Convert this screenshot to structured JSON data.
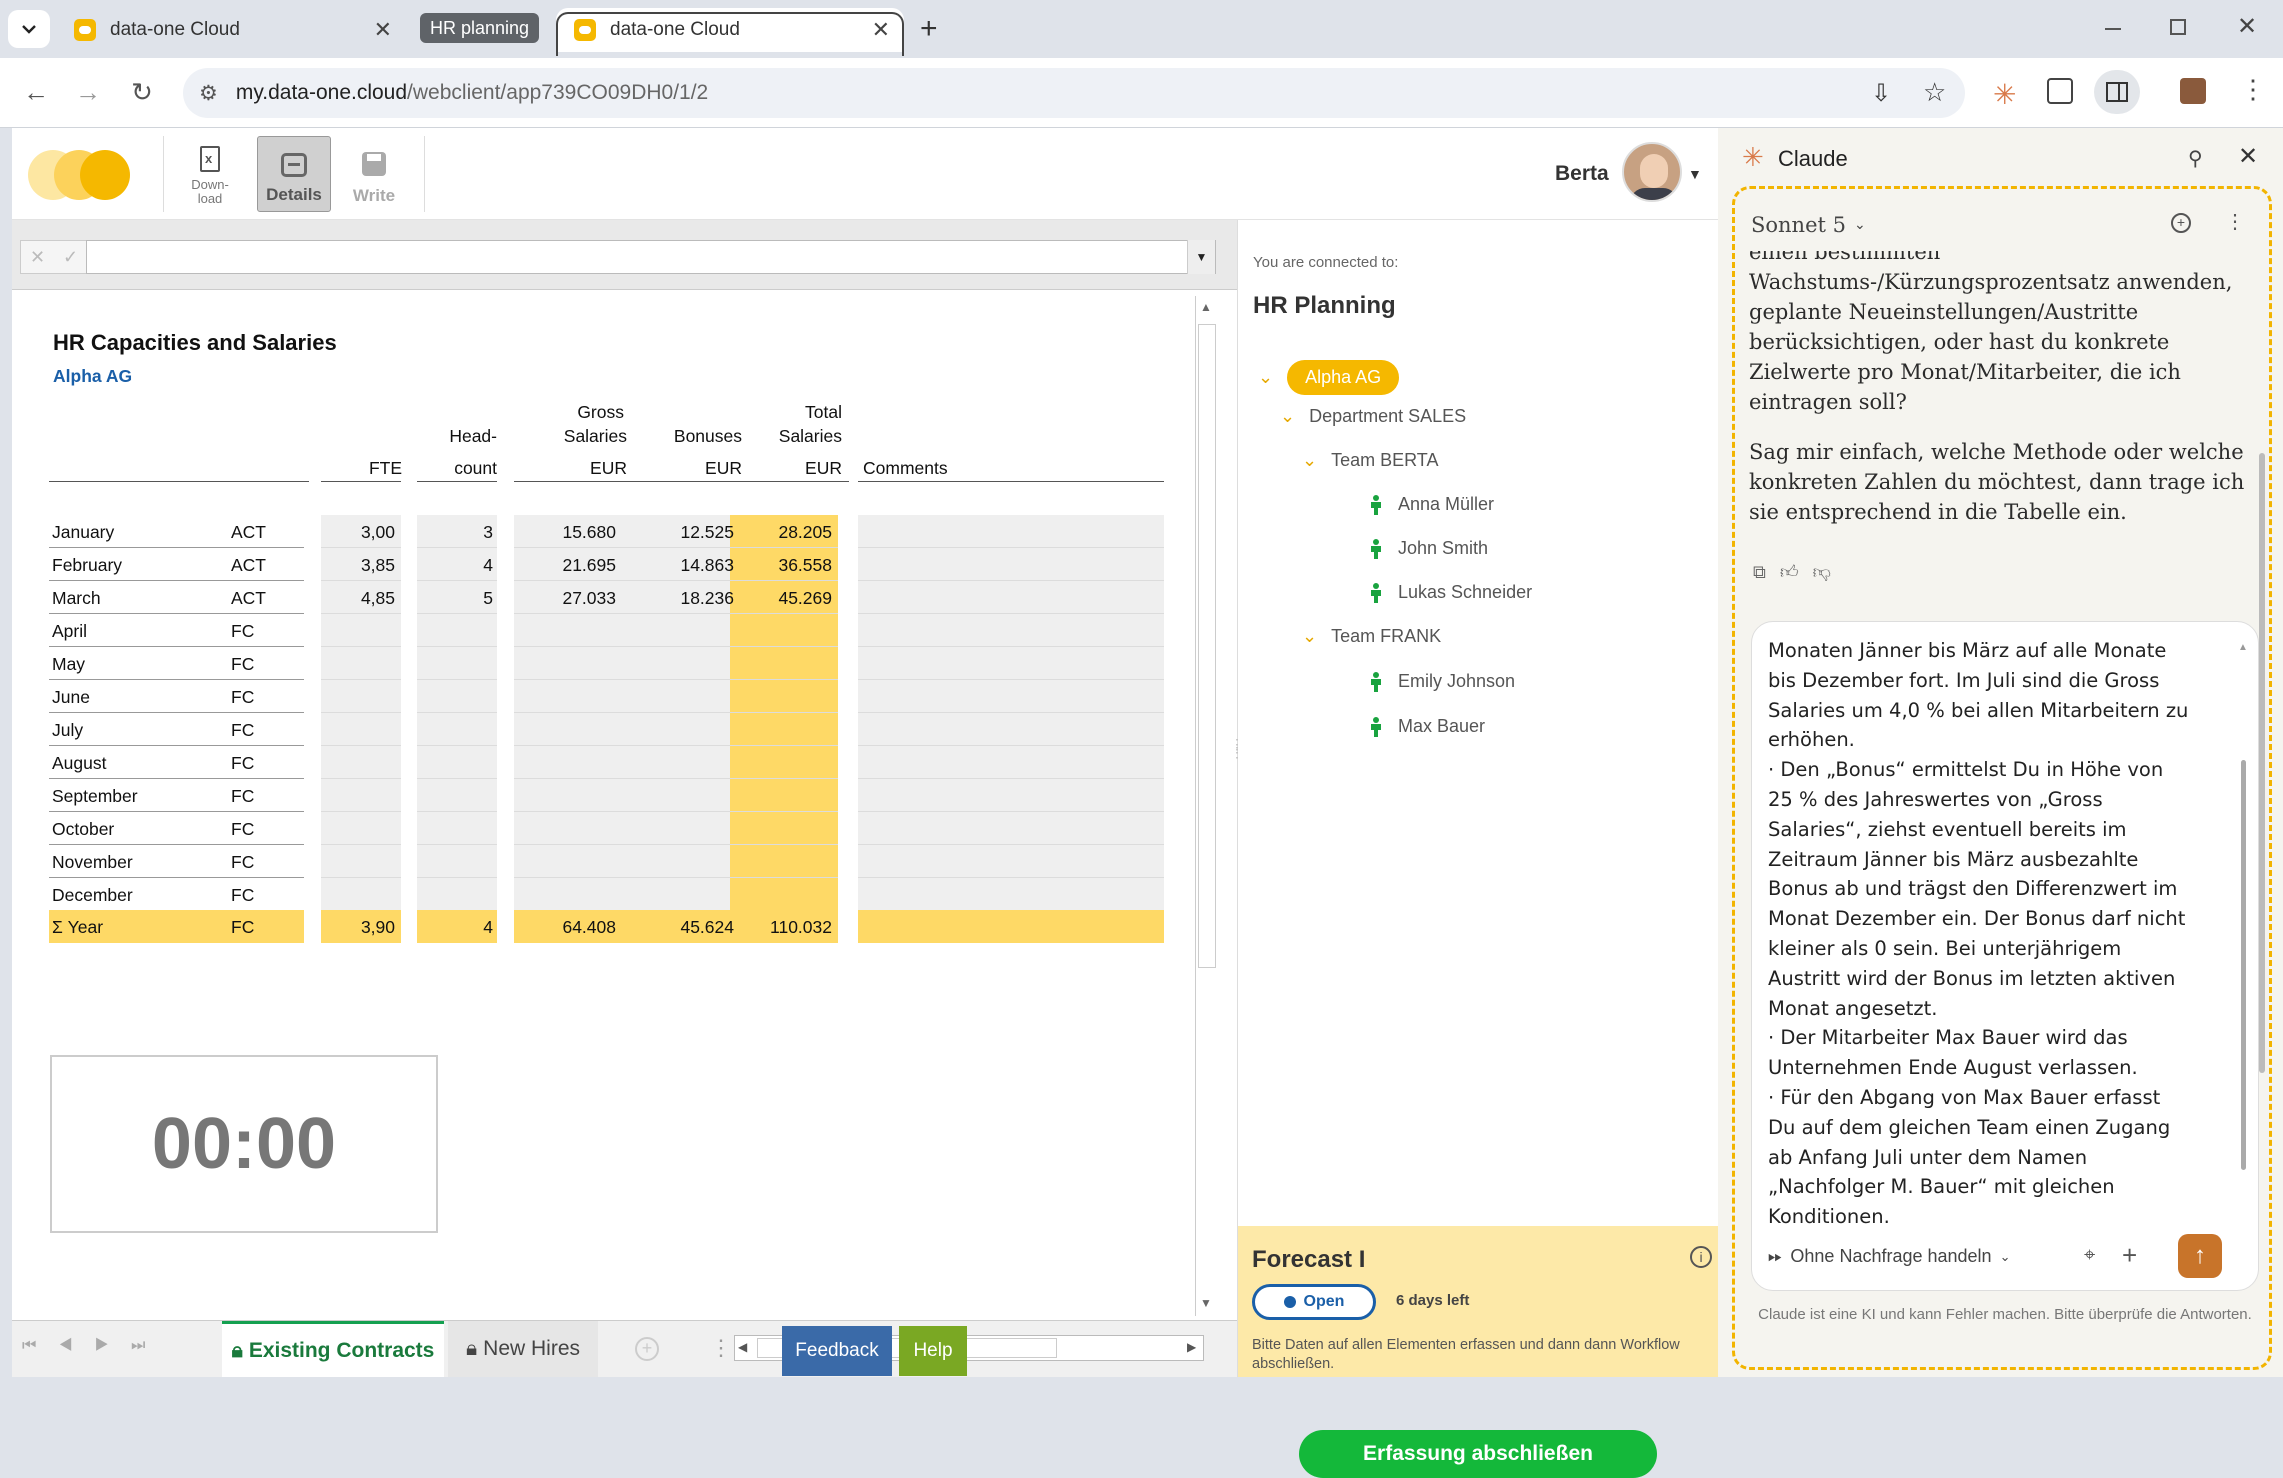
{
  "browser": {
    "tabs": [
      {
        "label": "data-one Cloud"
      },
      {
        "label": "HR planning"
      },
      {
        "label": "data-one Cloud"
      }
    ],
    "url_host": "my.data-one.cloud",
    "url_path": "/webclient/app739CO09DH0/1/2"
  },
  "toolbar": {
    "download_label": "Down-\nload",
    "details_label": "Details",
    "write_label": "Write",
    "user_name": "Berta"
  },
  "sheet": {
    "title": "HR Capacities and Salaries",
    "company": "Alpha AG",
    "headers": {
      "fte": "FTE",
      "headcount_1": "Head-",
      "headcount_2": "count",
      "gross_1": "Gross",
      "gross_2": "Salaries",
      "gross_3": "EUR",
      "bonuses_1": "Bonuses",
      "bonuses_2": "EUR",
      "total_1": "Total",
      "total_2": "Salaries",
      "total_3": "EUR",
      "comments": "Comments"
    },
    "rows": [
      {
        "month": "January",
        "type": "ACT",
        "fte": "3,00",
        "hc": "3",
        "gross": "15.680",
        "bonus": "12.525",
        "total": "28.205"
      },
      {
        "month": "February",
        "type": "ACT",
        "fte": "3,85",
        "hc": "4",
        "gross": "21.695",
        "bonus": "14.863",
        "total": "36.558"
      },
      {
        "month": "March",
        "type": "ACT",
        "fte": "4,85",
        "hc": "5",
        "gross": "27.033",
        "bonus": "18.236",
        "total": "45.269"
      },
      {
        "month": "April",
        "type": "FC",
        "fte": "",
        "hc": "",
        "gross": "",
        "bonus": "",
        "total": ""
      },
      {
        "month": "May",
        "type": "FC",
        "fte": "",
        "hc": "",
        "gross": "",
        "bonus": "",
        "total": ""
      },
      {
        "month": "June",
        "type": "FC",
        "fte": "",
        "hc": "",
        "gross": "",
        "bonus": "",
        "total": ""
      },
      {
        "month": "July",
        "type": "FC",
        "fte": "",
        "hc": "",
        "gross": "",
        "bonus": "",
        "total": ""
      },
      {
        "month": "August",
        "type": "FC",
        "fte": "",
        "hc": "",
        "gross": "",
        "bonus": "",
        "total": ""
      },
      {
        "month": "September",
        "type": "FC",
        "fte": "",
        "hc": "",
        "gross": "",
        "bonus": "",
        "total": ""
      },
      {
        "month": "October",
        "type": "FC",
        "fte": "",
        "hc": "",
        "gross": "",
        "bonus": "",
        "total": ""
      },
      {
        "month": "November",
        "type": "FC",
        "fte": "",
        "hc": "",
        "gross": "",
        "bonus": "",
        "total": ""
      },
      {
        "month": "December",
        "type": "FC",
        "fte": "",
        "hc": "",
        "gross": "",
        "bonus": "",
        "total": ""
      }
    ],
    "year_row": {
      "month": "Σ Year",
      "type": "FC",
      "fte": "3,90",
      "hc": "4",
      "gross": "64.408",
      "bonus": "45.624",
      "total": "110.032"
    },
    "timer": "00:00",
    "tabs": {
      "existing": "Existing Contracts",
      "new_hires": "New Hires",
      "feedback": "Feedback",
      "help": "Help"
    }
  },
  "panel": {
    "connected_label": "You are connected to:",
    "app_title": "HR Planning",
    "tree": {
      "company": "Alpha AG",
      "department": "Department SALES",
      "team1": "Team BERTA",
      "team1_members": [
        "Anna Müller",
        "John Smith",
        "Lukas Schneider"
      ],
      "team2": "Team FRANK",
      "team2_members": [
        "Emily Johnson",
        "Max Bauer"
      ]
    },
    "forecast": {
      "title": "Forecast I",
      "status": "Open",
      "days_left": "6 days left",
      "note": "Bitte Daten auf allen Elementen erfassen und dann dann Workflow abschließen.",
      "button": "Erfassung abschließen"
    }
  },
  "claude": {
    "title": "Claude",
    "model": "Sonnet 5",
    "response_lines": [
      "einen bestimmten",
      "Wachstums-/Kürzungsprozentsatz anwenden,",
      "geplante Neueinstellungen/Austritte",
      "berücksichtigen, oder hast du konkrete",
      "Zielwerte pro Monat/Mitarbeiter, die ich",
      "eintragen soll?"
    ],
    "response_para2": [
      "Sag mir einfach, welche Methode oder welche",
      "konkreten Zahlen du möchtest, dann trage ich",
      "sie entsprechend in die Tabelle ein."
    ],
    "input_lines": [
      "Monaten Jänner bis März auf alle Monate",
      "bis Dezember fort. Im Juli sind die Gross",
      "Salaries um 4,0 % bei allen Mitarbeitern zu",
      "erhöhen.",
      "·      Den „Bonus“ ermittelst Du in Höhe von",
      "25 % des Jahreswertes von „Gross",
      "Salaries“, ziehst eventuell bereits im",
      "Zeitraum Jänner bis März ausbezahlte",
      "Bonus ab und trägst den Differenzwert im",
      "Monat Dezember ein. Der Bonus darf nicht",
      "kleiner als 0 sein. Bei unterjährigem",
      "Austritt wird der Bonus im letzten aktiven",
      "Monat angesetzt.",
      "·      Der Mitarbeiter Max Bauer wird das",
      "Unternehmen Ende August verlassen.",
      "·      Für den Abgang von Max Bauer erfasst",
      "Du auf dem gleichen Team einen Zugang",
      "ab Anfang Juli unter dem Namen",
      "„Nachfolger M. Bauer“ mit gleichen",
      "Konditionen."
    ],
    "mode_label": "Ohne Nachfrage handeln",
    "disclaimer": "Claude ist eine KI und kann Fehler machen. Bitte überprüfe die Antworten."
  },
  "colors": {
    "accent_yellow": "#f5b800",
    "total_yellow": "#fed966",
    "button_green": "#14b83a",
    "link_blue": "#1a5fa8",
    "claude_orange": "#c8742a"
  }
}
